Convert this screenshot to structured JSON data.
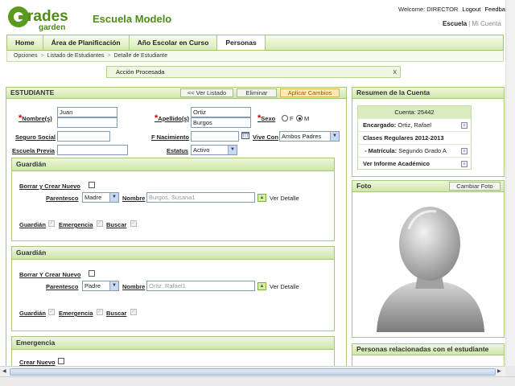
{
  "brand": {
    "logo_main": "Grades",
    "logo_sub": "garden",
    "school": "Escuela Modelo"
  },
  "user_bar": {
    "welcome": "Welcome: DIRECTOR",
    "logout": "Logout",
    "feedback": "Feedback",
    "escuela": "Escuela",
    "mi_cuenta": "Mi Cuenta"
  },
  "nav": {
    "tabs": [
      "Home",
      "Área de Planificación",
      "Año Escolar en Curso",
      "Personas"
    ],
    "active": "Personas"
  },
  "breadcrumb": [
    "Opciones",
    "Listado de Estudiantes",
    "Detalle de Estudiante"
  ],
  "message": {
    "text": "Acción Procesada",
    "close": "x"
  },
  "student": {
    "title": "ESTUDIANTE",
    "buttons": {
      "back": "<< Ver Listado",
      "delete": "Eliminar",
      "apply": "Aplicar Cambios"
    },
    "labels": {
      "nombres": "Nombre(s)",
      "apellidos": "Apellido(s)",
      "sexo": "Sexo",
      "ss": "Seguro Social",
      "fnac": "F Nacimiento",
      "vive": "Vive Con",
      "escuela": "Escuela Previa",
      "estatus": "Estatus",
      "f": "F",
      "m": "M"
    },
    "values": {
      "nombre1": "Juan",
      "nombre2": "",
      "apellido1": "Ortiz",
      "apellido2": "Burgos",
      "sexo": "M",
      "ss": "",
      "fnac": "",
      "vive": "Ambos Padres",
      "escuela": "",
      "estatus": "Activo"
    }
  },
  "guardians": [
    {
      "title": "Guardián",
      "clear": "Borrar y Crear Nuevo",
      "parentesco_label": "Parentesco",
      "parentesco": "Madre",
      "nombre_label": "Nombre",
      "nombre": "Burgos, Susana1",
      "detalle": "Ver Detalle",
      "checks": [
        "Guardián",
        "Emergencia",
        "Buscar"
      ]
    },
    {
      "title": "Guardián",
      "clear": "Borrar Y Crear Nuevo",
      "parentesco_label": "Parentesco",
      "parentesco": "Padre",
      "nombre_label": "Nombre",
      "nombre": "Ortiz, Rafael1",
      "detalle": "Ver Detalle",
      "checks": [
        "Guardián",
        "Emergencia",
        "Buscar"
      ]
    }
  ],
  "emergencia": {
    "title": "Emergencia",
    "clear": "Crear Nuevo"
  },
  "resumen": {
    "title": "Resumen de la Cuenta",
    "cuenta": "Cuenta: 25442",
    "encargado_label": "Encargado:",
    "encargado": "Ortiz, Rafael",
    "clases": "Clases Regulares 2012-2013",
    "matricula_label": "Matrícula:",
    "matricula": "Segundo Grado A",
    "informe": "Ver Informe Académico"
  },
  "foto": {
    "title": "Foto",
    "change": "Cambiar Foto"
  },
  "relacionadas": {
    "title": "Personas relacionadas con el estudiante"
  },
  "colors": {
    "accent": "#4f8a1a",
    "panel_border": "#a5c97c",
    "apply_button": "#fde9b8"
  }
}
